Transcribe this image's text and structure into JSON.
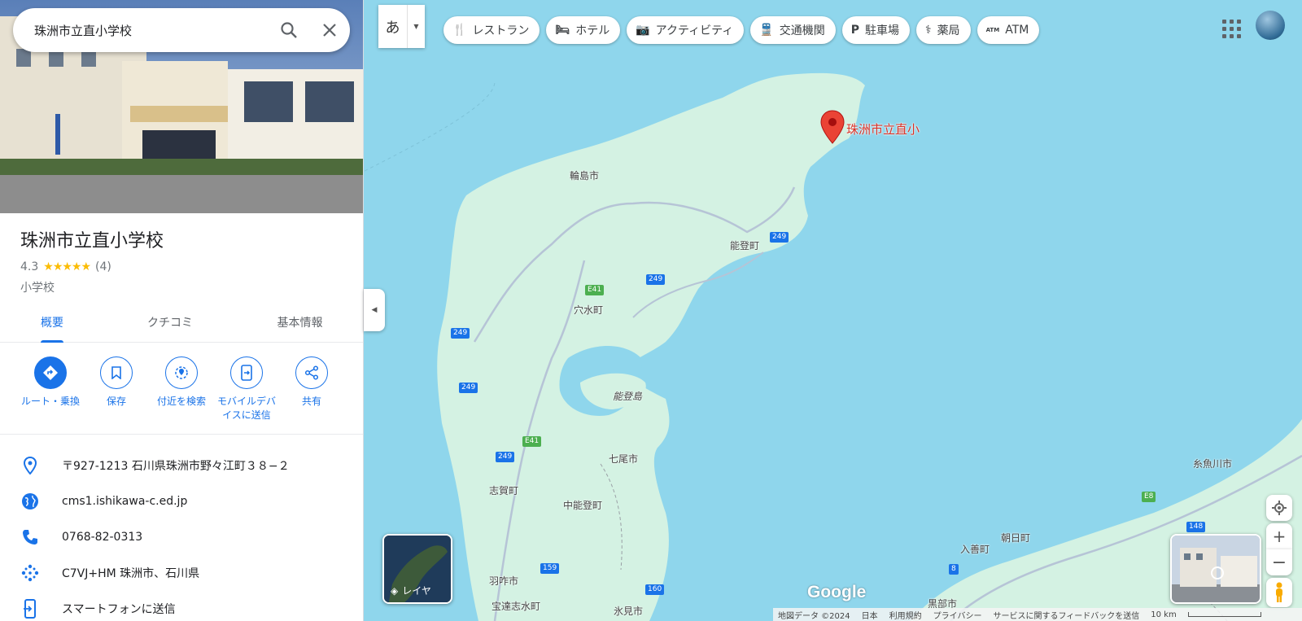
{
  "search": {
    "query": "珠洲市立直小学校"
  },
  "place": {
    "name": "珠洲市立直小学校",
    "rating": "4.3",
    "stars": "★★★★★",
    "review_count": "(4)",
    "category": "小学校"
  },
  "tabs": [
    {
      "label": "概要",
      "active": true
    },
    {
      "label": "クチコミ",
      "active": false
    },
    {
      "label": "基本情報",
      "active": false
    }
  ],
  "actions": [
    {
      "label": "ルート・乗換",
      "icon": "directions-icon"
    },
    {
      "label": "保存",
      "icon": "bookmark-icon"
    },
    {
      "label": "付近を検索",
      "icon": "nearby-icon"
    },
    {
      "label": "モバイルデバイスに送信",
      "icon": "send-to-phone-icon"
    },
    {
      "label": "共有",
      "icon": "share-icon"
    }
  ],
  "info": [
    {
      "text": "〒927-1213 石川県珠洲市野々江町３８−２",
      "icon": "location-pin-icon"
    },
    {
      "text": "cms1.ishikawa-c.ed.jp",
      "icon": "globe-icon"
    },
    {
      "text": "0768-82-0313",
      "icon": "phone-icon"
    },
    {
      "text": "C7VJ+HM 珠洲市、石川県",
      "icon": "plus-code-icon"
    },
    {
      "text": "スマートフォンに送信",
      "icon": "phone-send-icon"
    }
  ],
  "ime": {
    "label": "あ"
  },
  "chips": [
    {
      "label": "レストラン",
      "icon": "restaurant-icon",
      "glyph": "🍴"
    },
    {
      "label": "ホテル",
      "icon": "hotel-icon",
      "glyph": "🛏"
    },
    {
      "label": "アクティビティ",
      "icon": "camera-icon",
      "glyph": "📷"
    },
    {
      "label": "交通機関",
      "icon": "train-icon",
      "glyph": "🚆"
    },
    {
      "label": "駐車場",
      "icon": "parking-icon",
      "glyph": "P"
    },
    {
      "label": "薬局",
      "icon": "pharmacy-icon",
      "glyph": "⚕"
    },
    {
      "label": "ATM",
      "icon": "atm-icon",
      "glyph": "ATM"
    }
  ],
  "map": {
    "pin_label": "珠洲市立直小",
    "places": [
      "輪島市",
      "能登町",
      "穴水町",
      "能登島",
      "七尾市",
      "志賀町",
      "中能登町",
      "羽咋市",
      "宝達志水町",
      "氷見市",
      "糸魚川市",
      "朝日町",
      "入善町",
      "黒部市"
    ],
    "routes": [
      "249",
      "249",
      "249",
      "249",
      "249",
      "E41",
      "E41",
      "159",
      "160",
      "148",
      "8",
      "E8"
    ],
    "layers_label": "レイヤ",
    "google": "Google"
  },
  "footer": {
    "items": [
      "地図データ ©2024",
      "日本",
      "利用規約",
      "プライバシー",
      "サービスに関するフィードバックを送信"
    ],
    "scale": "10 km"
  },
  "colors": {
    "accent": "#1a73e8",
    "pin": "#d93025",
    "water": "#8fd6ec",
    "land": "#d4f2e3"
  }
}
